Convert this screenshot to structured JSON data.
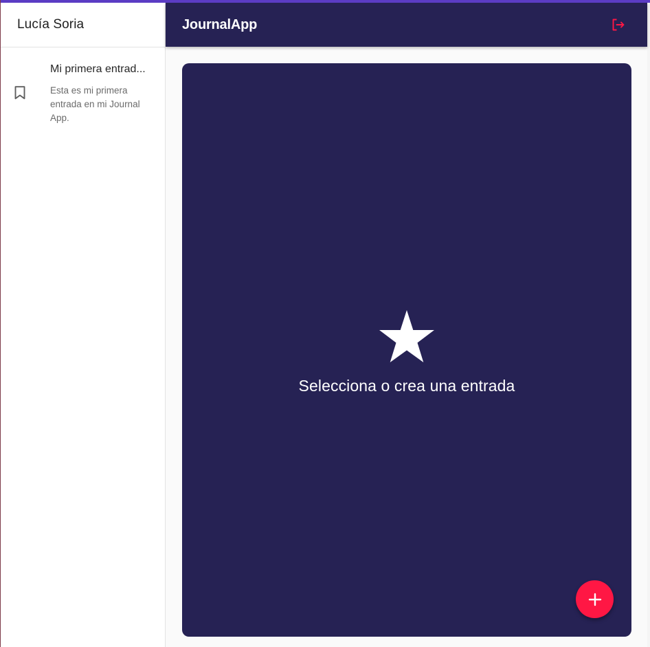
{
  "sidebar": {
    "user_name": "Lucía Soria",
    "entries": [
      {
        "title": "Mi primera entrad...",
        "body": "Esta es mi primera entrada en mi Journal App.",
        "icon": "bookmark-border-icon"
      }
    ]
  },
  "appbar": {
    "title": "JournalApp",
    "logout_icon": "logout-icon"
  },
  "main": {
    "empty_message": "Selecciona o crea una entrada",
    "empty_icon": "star-icon"
  },
  "fab": {
    "icon": "add-icon"
  },
  "colors": {
    "primary": "#262254",
    "accent": "#ff1744",
    "top_border": "#5b3cc4"
  }
}
